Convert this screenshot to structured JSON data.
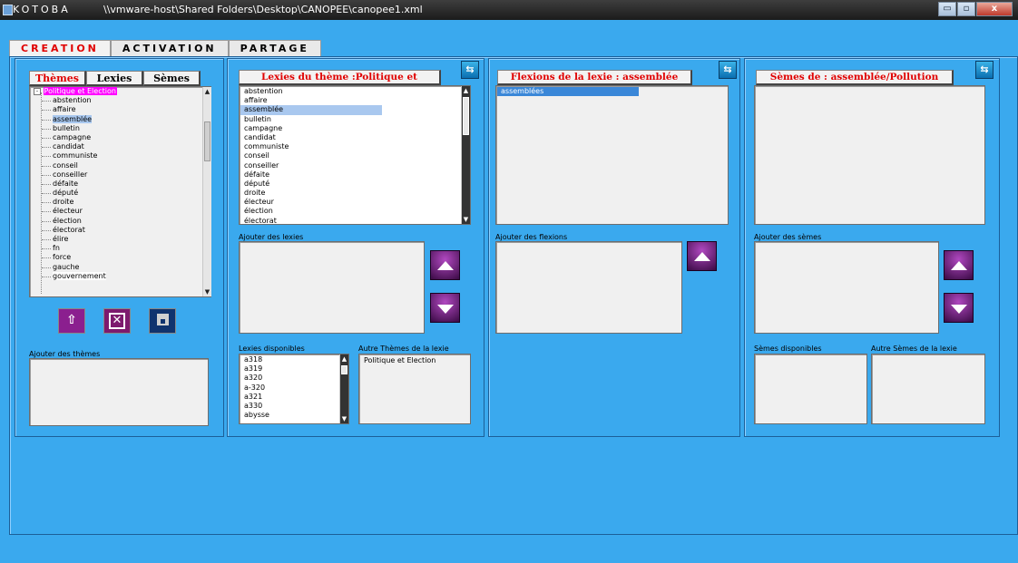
{
  "window": {
    "app_name": "KOTOBA",
    "path": "\\\\vmware-host\\Shared Folders\\Desktop\\CANOPEE\\canopee1.xml",
    "min_label": "▭",
    "max_label": "▫",
    "close_label": "x"
  },
  "tabs": [
    "CREATION",
    "ACTIVATION",
    "PARTAGE"
  ],
  "themes_panel": {
    "subtabs": [
      "Thèmes",
      "Lexies",
      "Sèmes"
    ],
    "root": "Politique et Election",
    "items": [
      "abstention",
      "affaire",
      "assemblée",
      "bulletin",
      "campagne",
      "candidat",
      "communiste",
      "conseil",
      "conseiller",
      "défaite",
      "député",
      "droite",
      "électeur",
      "élection",
      "électorat",
      "élire",
      "fn",
      "force",
      "gauche",
      "gouvernement"
    ],
    "add_label": "Ajouter des thèmes"
  },
  "lexies_panel": {
    "header": "Lexies du thème :Politique et Election",
    "items": [
      "abstention",
      "affaire",
      "assemblée",
      "bulletin",
      "campagne",
      "candidat",
      "communiste",
      "conseil",
      "conseiller",
      "défaite",
      "député",
      "droite",
      "électeur",
      "élection",
      "électorat"
    ],
    "add_label": "Ajouter des lexies",
    "available_label": "Lexies disponibles",
    "available_items": [
      "a318",
      "a319",
      "a320",
      "a-320",
      "a321",
      "a330",
      "abysse"
    ],
    "other_themes_label": "Autre Thèmes de la lexie",
    "other_themes_items": [
      "Politique et Election"
    ]
  },
  "flexions_panel": {
    "header": "Flexions de la lexie : assemblée",
    "items": [
      "assemblées"
    ],
    "add_label": "Ajouter des flexions"
  },
  "semes_panel": {
    "header": "Sèmes de : assemblée/Pollution",
    "add_label": "Ajouter des sèmes",
    "available_label": "Sèmes disponibles",
    "other_label": "Autre Sèmes de la lexie"
  },
  "colors": {
    "background": "#3aa9ee",
    "accent_red": "#e00000",
    "selection_magenta": "#ff00ff",
    "selection_blue": "#a9c8ef"
  },
  "icons": {
    "swap": "swap-arrows-icon",
    "up": "up-arrow-icon",
    "down": "down-arrow-icon",
    "upload": "upload-icon",
    "delete": "delete-icon",
    "save": "save-icon"
  }
}
